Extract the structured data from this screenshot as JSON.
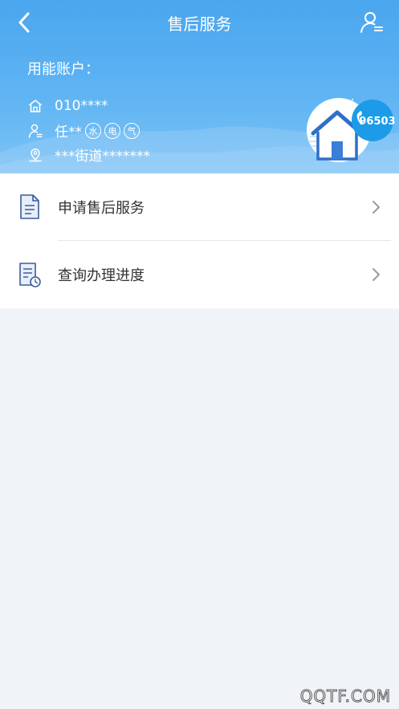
{
  "header": {
    "title": "售后服务",
    "account_label": "用能账户：",
    "account_number": "010****",
    "account_name": "任**",
    "badges": [
      "水",
      "电",
      "气"
    ],
    "address": "***街道*******",
    "hotline": "96503",
    "icons": {
      "back": "back-arrow-icon",
      "user": "user-list-icon",
      "home": "home-icon",
      "person": "person-icon",
      "location": "location-icon"
    }
  },
  "menu": {
    "items": [
      {
        "label": "申请售后服务",
        "icon": "document-icon"
      },
      {
        "label": "查询办理进度",
        "icon": "document-clock-icon"
      }
    ]
  },
  "watermark": "QQTF.COM",
  "colors": {
    "header_top": "#4aa6ee",
    "header_bottom": "#7ec3f6",
    "page_bg": "#f0f4f8",
    "text_main": "#333333"
  }
}
